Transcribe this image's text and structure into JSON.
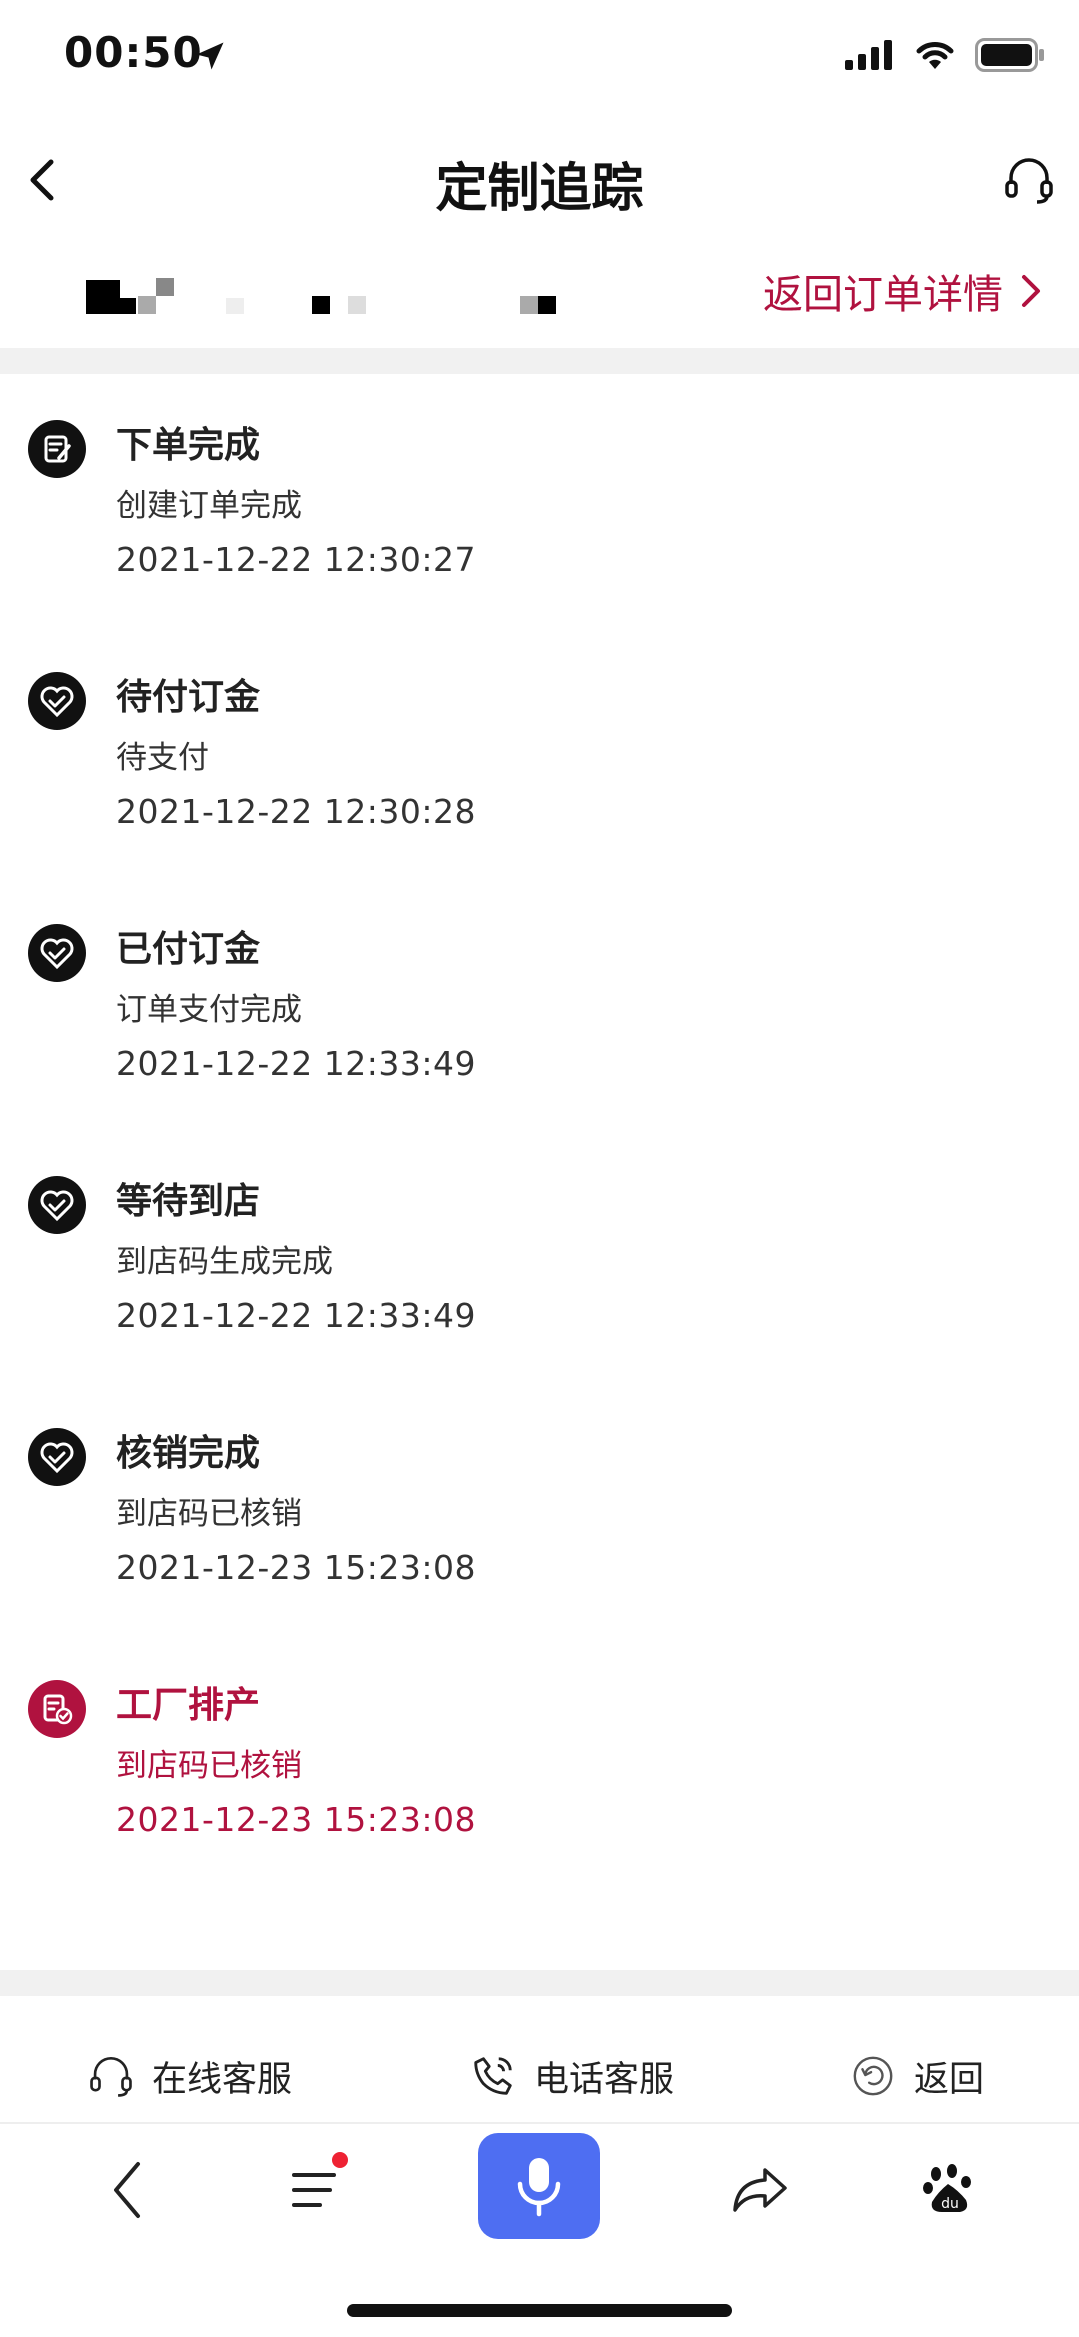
{
  "status_bar": {
    "time": "00:50"
  },
  "nav": {
    "title": "定制追踪",
    "back_icon": "chevron-left-icon",
    "support_icon": "headset-icon"
  },
  "order_bar": {
    "back_to_detail": "返回订单详情"
  },
  "timeline": [
    {
      "title": "下单完成",
      "desc": "创建订单完成",
      "time": "2021-12-22 12:30:27",
      "icon": "order-form-icon"
    },
    {
      "title": "待付订金",
      "desc": "待支付",
      "time": "2021-12-22 12:30:28",
      "icon": "check-heart-icon"
    },
    {
      "title": "已付订金",
      "desc": "订单支付完成",
      "time": "2021-12-22 12:33:49",
      "icon": "check-heart-icon"
    },
    {
      "title": "等待到店",
      "desc": "到店码生成完成",
      "time": "2021-12-22 12:33:49",
      "icon": "check-heart-icon"
    },
    {
      "title": "核销完成",
      "desc": "到店码已核销",
      "time": "2021-12-23 15:23:08",
      "icon": "check-heart-icon"
    },
    {
      "title": "工厂排产",
      "desc": "到店码已核销",
      "time": "2021-12-23 15:23:08",
      "icon": "factory-check-icon"
    }
  ],
  "actions": {
    "online_service": "在线客服",
    "phone_service": "电话客服",
    "back": "返回"
  },
  "colors": {
    "accent": "#b0123f",
    "mic_button": "#4e6ef2",
    "badge": "#ee2233"
  }
}
